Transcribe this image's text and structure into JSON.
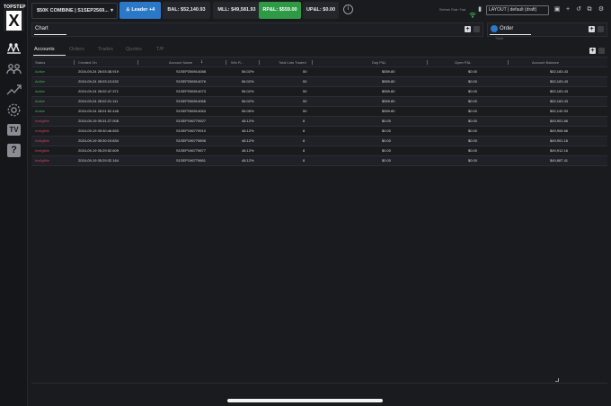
{
  "brand": {
    "name": "TOPSTEP",
    "mark": "X"
  },
  "rail": {
    "icons": [
      "exchange-icon",
      "people-icon",
      "chart-line-icon",
      "gear-icon",
      "tv-icon",
      "help-icon"
    ],
    "tv_label": "TV",
    "help_label": "?"
  },
  "topbar": {
    "account_select": "$50K COMBINE | S1SEP2569...",
    "leader_button": "Leader +4",
    "bal": "BAL: $52,140.93",
    "mll": "MLL: $49,581.93",
    "rpnl": "RP&L: $559.00",
    "upnl": "UP&L: $0.00",
    "info": "i",
    "refresh_rate": "Refresh Rate: Fast",
    "layout": "LAYOUT | default (draft)"
  },
  "chart_panel": {
    "title": "Chart"
  },
  "order_panel": {
    "title": "Order",
    "sub": "Ticket"
  },
  "tabs": [
    "Accounts",
    "Orders",
    "Trades",
    "Quotes",
    "T/P"
  ],
  "columns": [
    "Status",
    "Created On",
    "Account Name",
    "Win R...",
    "Total Lots Traded",
    "Day P&L",
    "Open P&L",
    "Account Balance"
  ],
  "rows": [
    {
      "status": "Active",
      "created": "2024-09-24 28:03:38.919",
      "name": "S1SEP256914088",
      "win": "56.02%",
      "lots": "50",
      "day": "$559.80",
      "open": "$0.00",
      "balance": "$52,183.43"
    },
    {
      "status": "Active",
      "created": "2024-09-24 28:03:13.632",
      "name": "S1SEP256914076",
      "win": "56.02%",
      "lots": "50",
      "day": "$559.80",
      "open": "$0.00",
      "balance": "$52,183.43"
    },
    {
      "status": "Active",
      "created": "2024-09-24 28:02:47.371",
      "name": "S1SEP256914073",
      "win": "56.02%",
      "lots": "50",
      "day": "$559.80",
      "open": "$0.00",
      "balance": "$52,183.43"
    },
    {
      "status": "Active",
      "created": "2024-09-24 28:02:21.111",
      "name": "S1SEP256914066",
      "win": "56.02%",
      "lots": "50",
      "day": "$559.80",
      "open": "$0.00",
      "balance": "$52,183.43"
    },
    {
      "status": "Active",
      "created": "2024-09-24 28:01:52.448",
      "name": "S1SEP256914063",
      "win": "56.06%",
      "lots": "50",
      "day": "$559.80",
      "open": "$0.00",
      "balance": "$52,140.93"
    },
    {
      "status": "Ineligible",
      "created": "2024-09-19 05:31:27.008",
      "name": "S1SEP196779927",
      "win": "48.12%",
      "lots": "8",
      "day": "$0.00",
      "open": "$0.00",
      "balance": "$49,901.66"
    },
    {
      "status": "Ineligible",
      "created": "2024-09-19 05:30:46.653",
      "name": "S1SEP196779910",
      "win": "48.12%",
      "lots": "8",
      "day": "$0.00",
      "open": "$0.00",
      "balance": "$49,906.66"
    },
    {
      "status": "Ineligible",
      "created": "2024-09-19 05:30:19.834",
      "name": "S1SEP196779896",
      "win": "48.12%",
      "lots": "8",
      "day": "$0.00",
      "open": "$0.00",
      "balance": "$49,901.16"
    },
    {
      "status": "Ineligible",
      "created": "2024-09-19 05:29:52.609",
      "name": "S1SEP196779877",
      "win": "48.12%",
      "lots": "8",
      "day": "$0.00",
      "open": "$0.00",
      "balance": "$49,912.16"
    },
    {
      "status": "Ineligible",
      "created": "2024-09-19 05:29:32.164",
      "name": "S1SEP196779861",
      "win": "48.12%",
      "lots": "8",
      "day": "$0.00",
      "open": "$0.00",
      "balance": "$49,887.41"
    }
  ],
  "colors": {
    "active": "#45b552",
    "ineligible": "#c9435a",
    "leader": "#2a78c7",
    "rpnl": "#2f9a45"
  }
}
